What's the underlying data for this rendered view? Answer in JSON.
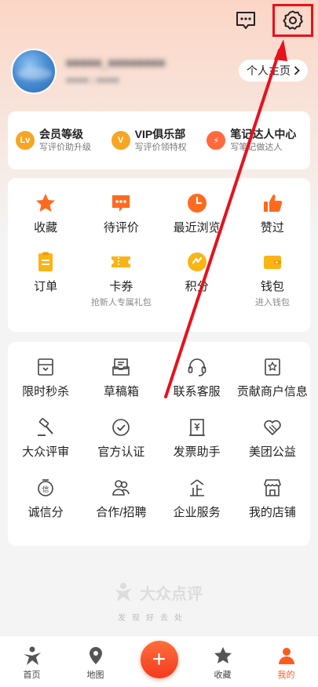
{
  "header": {
    "message_icon": "message-icon",
    "settings_icon": "gear-icon"
  },
  "profile": {
    "homepage_label": "个人主页"
  },
  "member": [
    {
      "icon": "Lv",
      "color": "#f6a623",
      "title": "会员等级",
      "sub": "写评价助升级"
    },
    {
      "icon": "V",
      "color": "#f6a623",
      "title": "VIP俱乐部",
      "sub": "写评价领特权"
    },
    {
      "icon": "⚡",
      "color": "#ff6a3d",
      "title": "笔记达人中心",
      "sub": "写笔记做达人"
    }
  ],
  "grid1": [
    {
      "label": "收藏",
      "icon": "star-icon",
      "sub": ""
    },
    {
      "label": "待评价",
      "icon": "comment-icon",
      "sub": ""
    },
    {
      "label": "最近浏览",
      "icon": "clock-icon",
      "sub": ""
    },
    {
      "label": "赞过",
      "icon": "thumbs-up-icon",
      "sub": ""
    },
    {
      "label": "订单",
      "icon": "order-icon",
      "sub": ""
    },
    {
      "label": "卡券",
      "icon": "ticket-icon",
      "sub": "抢新人专属礼包"
    },
    {
      "label": "积分",
      "icon": "points-icon",
      "sub": ""
    },
    {
      "label": "钱包",
      "icon": "wallet-icon",
      "sub": "进入钱包"
    }
  ],
  "grid2": [
    {
      "label": "限时秒杀",
      "icon": "flash-sale-icon"
    },
    {
      "label": "草稿箱",
      "icon": "drafts-icon"
    },
    {
      "label": "联系客服",
      "icon": "headset-icon"
    },
    {
      "label": "贡献商户信息",
      "icon": "badge-icon"
    },
    {
      "label": "大众评审",
      "icon": "gavel-icon"
    },
    {
      "label": "官方认证",
      "icon": "check-circle-icon"
    },
    {
      "label": "发票助手",
      "icon": "invoice-icon"
    },
    {
      "label": "美团公益",
      "icon": "charity-icon"
    },
    {
      "label": "诚信分",
      "icon": "credit-icon"
    },
    {
      "label": "合作/招聘",
      "icon": "people-icon"
    },
    {
      "label": "企业服务",
      "icon": "enterprise-icon"
    },
    {
      "label": "我的店铺",
      "icon": "shop-icon"
    }
  ],
  "watermark": {
    "text": "大众点评",
    "sub": "发现好去处"
  },
  "nav": [
    {
      "label": "首页",
      "icon": "home-icon"
    },
    {
      "label": "地图",
      "icon": "map-pin-icon"
    },
    {
      "label": "",
      "icon": "plus-icon"
    },
    {
      "label": "收藏",
      "icon": "star-icon"
    },
    {
      "label": "我的",
      "icon": "profile-icon"
    }
  ],
  "colors": {
    "accent": "#ff5a1e",
    "highlight": "#e8111c"
  }
}
